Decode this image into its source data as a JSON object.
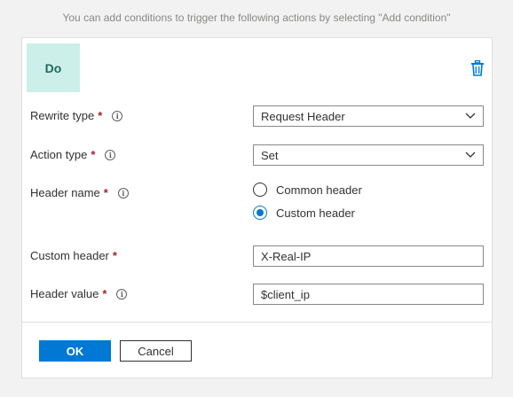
{
  "hint": "You can add conditions to trigger the following actions by selecting \"Add condition\"",
  "badge": "Do",
  "icons": {
    "delete": "trash-icon",
    "info": "info-icon",
    "dropdown": "chevron-down-icon"
  },
  "colors": {
    "accent": "#0078d4",
    "badge_bg": "#cdefe9",
    "required": "#a4262c"
  },
  "fields": {
    "rewrite_type": {
      "label": "Rewrite type",
      "required": "*",
      "value": "Request Header"
    },
    "action_type": {
      "label": "Action type",
      "required": "*",
      "value": "Set"
    },
    "header_name": {
      "label": "Header name",
      "required": "*",
      "options": [
        "Common header",
        "Custom header"
      ],
      "selected": "Custom header"
    },
    "custom_header": {
      "label": "Custom header",
      "required": "*",
      "value": "X-Real-IP"
    },
    "header_value": {
      "label": "Header value",
      "required": "*",
      "value": "$client_ip"
    }
  },
  "buttons": {
    "ok": "OK",
    "cancel": "Cancel"
  }
}
